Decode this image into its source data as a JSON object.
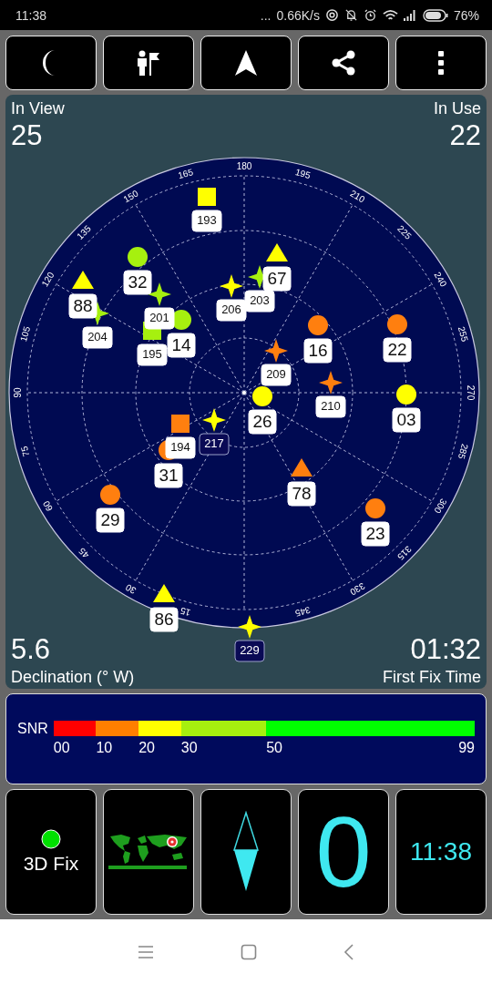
{
  "status_bar": {
    "time": "11:38",
    "dots": "...",
    "speed": "0.66K/s",
    "battery": "76%"
  },
  "sky": {
    "in_view_label": "In View",
    "in_view": "25",
    "in_use_label": "In Use",
    "in_use": "22",
    "azimuth_labels": [
      "180",
      "195",
      "210",
      "225",
      "240",
      "255",
      "270",
      "285",
      "300",
      "315",
      "330",
      "345",
      "15",
      "30",
      "45",
      "60",
      "75",
      "90",
      "105",
      "120",
      "135",
      "150",
      "165"
    ],
    "satellites": [
      {
        "id": "193",
        "kind": "square",
        "color": "#ffff00",
        "used": true
      },
      {
        "id": "67",
        "kind": "triangle",
        "color": "#ffff00",
        "used": true
      },
      {
        "id": "32",
        "kind": "circle",
        "color": "#a6f00f",
        "used": true
      },
      {
        "id": "88",
        "kind": "triangle",
        "color": "#ffff00",
        "used": true
      },
      {
        "id": "203",
        "kind": "star",
        "color": "#a6f00f",
        "used": true
      },
      {
        "id": "201",
        "kind": "star",
        "color": "#a6f00f",
        "used": true
      },
      {
        "id": "206",
        "kind": "star",
        "color": "#ffff00",
        "used": true
      },
      {
        "id": "204",
        "kind": "star",
        "color": "#a6f00f",
        "used": true
      },
      {
        "id": "195",
        "kind": "square",
        "color": "#a6f00f",
        "used": true
      },
      {
        "id": "14",
        "kind": "circle",
        "color": "#a6f00f",
        "used": true
      },
      {
        "id": "16",
        "kind": "circle",
        "color": "#ff7f0f",
        "used": true
      },
      {
        "id": "22",
        "kind": "circle",
        "color": "#ff7f0f",
        "used": true
      },
      {
        "id": "209",
        "kind": "star",
        "color": "#ff7f0f",
        "used": true
      },
      {
        "id": "210",
        "kind": "star",
        "color": "#ff7f0f",
        "used": true
      },
      {
        "id": "26",
        "kind": "circle",
        "color": "#ffff00",
        "used": true
      },
      {
        "id": "03",
        "kind": "circle",
        "color": "#ffff00",
        "used": true
      },
      {
        "id": "194",
        "kind": "square",
        "color": "#ff7f0f",
        "used": true
      },
      {
        "id": "217",
        "kind": "star",
        "color": "#ffff00",
        "used": false
      },
      {
        "id": "31",
        "kind": "circle",
        "color": "#ff7f0f",
        "used": true
      },
      {
        "id": "78",
        "kind": "triangle",
        "color": "#ff7f0f",
        "used": true
      },
      {
        "id": "29",
        "kind": "circle",
        "color": "#ff7f0f",
        "used": true
      },
      {
        "id": "23",
        "kind": "circle",
        "color": "#ff7f0f",
        "used": true
      },
      {
        "id": "86",
        "kind": "triangle",
        "color": "#ffff00",
        "used": true
      },
      {
        "id": "229",
        "kind": "star",
        "color": "#ffff00",
        "used": false
      }
    ],
    "declination": "5.6",
    "declination_label": "Declination (° W)",
    "first_fix": "01:32",
    "first_fix_label": "First Fix Time"
  },
  "snr": {
    "label": "SNR",
    "segments": [
      {
        "color": "#ff0000"
      },
      {
        "color": "#ff7f00"
      },
      {
        "color": "#ffff00"
      },
      {
        "color": "#a6f00f"
      },
      {
        "color": "#00ff00"
      }
    ],
    "ticks": [
      "00",
      "10",
      "20",
      "30",
      "50",
      "99"
    ]
  },
  "tiles": {
    "fix": "3D Fix",
    "speed": "0",
    "clock": "11:38"
  }
}
